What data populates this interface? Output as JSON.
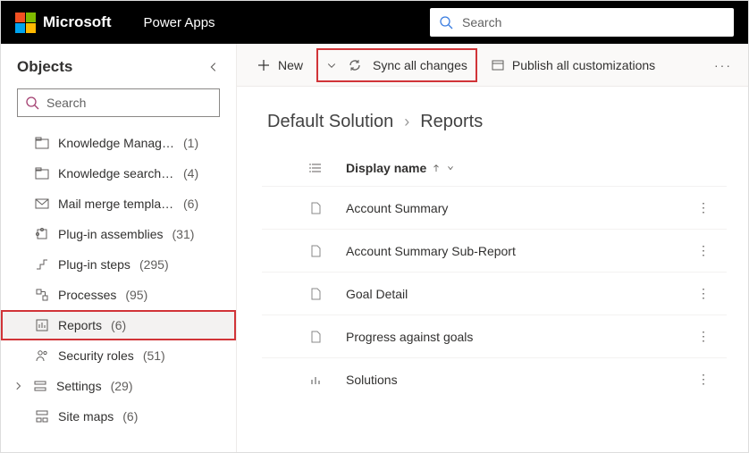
{
  "header": {
    "brand": "Microsoft",
    "app": "Power Apps",
    "search_placeholder": "Search"
  },
  "sidebar": {
    "title": "Objects",
    "search_placeholder": "Search",
    "items": [
      {
        "label": "Knowledge Manage…",
        "count": "(1)"
      },
      {
        "label": "Knowledge search fil…",
        "count": "(4)"
      },
      {
        "label": "Mail merge templates",
        "count": "(6)"
      },
      {
        "label": "Plug-in assemblies",
        "count": "(31)"
      },
      {
        "label": "Plug-in steps",
        "count": "(295)"
      },
      {
        "label": "Processes",
        "count": "(95)"
      },
      {
        "label": "Reports",
        "count": "(6)"
      },
      {
        "label": "Security roles",
        "count": "(51)"
      },
      {
        "label": "Settings",
        "count": "(29)"
      },
      {
        "label": "Site maps",
        "count": "(6)"
      }
    ]
  },
  "toolbar": {
    "new": "New",
    "sync": "Sync all changes",
    "publish": "Publish all customizations"
  },
  "breadcrumb": {
    "root": "Default Solution",
    "leaf": "Reports"
  },
  "table": {
    "header": "Display name",
    "rows": [
      {
        "name": "Account Summary"
      },
      {
        "name": "Account Summary Sub-Report"
      },
      {
        "name": "Goal Detail"
      },
      {
        "name": "Progress against goals"
      },
      {
        "name": "Solutions"
      }
    ]
  }
}
